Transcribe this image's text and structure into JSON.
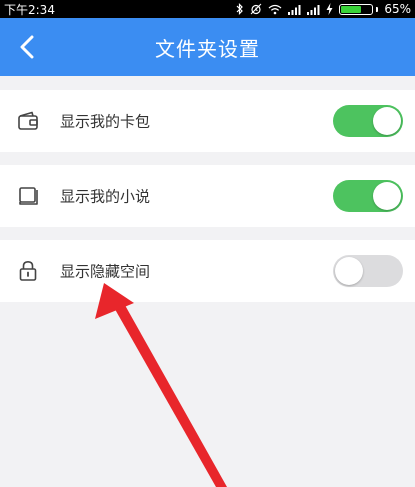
{
  "status_bar": {
    "time": "下午2:34",
    "battery_percent": "65%",
    "battery_level": 0.65,
    "icons": [
      "bluetooth-icon",
      "alarm-icon",
      "wifi-icon",
      "signal-icon",
      "signal-icon",
      "charging-icon",
      "battery-icon"
    ]
  },
  "header": {
    "title": "文件夹设置",
    "back_icon": "chevron-left-icon"
  },
  "settings": [
    {
      "label": "显示我的卡包",
      "icon": "wallet-icon",
      "enabled": true
    },
    {
      "label": "显示我的小说",
      "icon": "book-icon",
      "enabled": true
    },
    {
      "label": "显示隐藏空间",
      "icon": "lock-icon",
      "enabled": false
    }
  ],
  "colors": {
    "app_bar": "#3b8df2",
    "toggle_on": "#4dc35f",
    "toggle_off": "#dcdcde",
    "annotation_arrow": "#e8262b"
  }
}
